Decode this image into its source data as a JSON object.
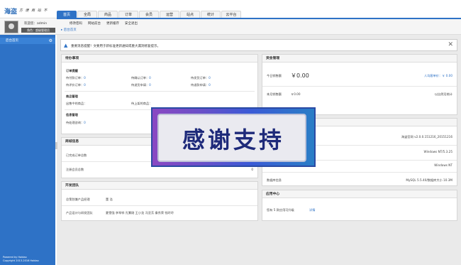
{
  "brand": {
    "logo": "海盗",
    "tagline": "方 便 商 站 不"
  },
  "nav": [
    "首页",
    "全局",
    "商品",
    "订单",
    "会员",
    "运营",
    "站点",
    "统计",
    "云平台"
  ],
  "user": {
    "welcome": "欢迎您：admin",
    "role": "角色：超级管理员",
    "links": [
      "修改密码",
      "网站前台",
      "更新缓存",
      "安全退出"
    ]
  },
  "sidebar": {
    "item": "后台首页",
    "footer": [
      "Powered by Haidao",
      "Copyright 2013-2016 Haidao"
    ]
  },
  "breadcrumb": "后台首页",
  "notice": "重要消息提醒！文要用于新标准更新通知或重大漏洞修复提示。",
  "todo": {
    "title": "待办事项",
    "order_title": "订单提醒",
    "order": [
      {
        "label": "待付款订单：",
        "value": "0"
      },
      {
        "label": "待确认订单：",
        "value": "0"
      },
      {
        "label": "待发货订单：",
        "value": "0"
      },
      {
        "label": "待评价订单：",
        "value": "0"
      },
      {
        "label": "待退货申请：",
        "value": "0"
      },
      {
        "label": "待退款申请：",
        "value": "0"
      }
    ],
    "goods_title": "商品管理",
    "goods": [
      {
        "label": "出售中的商品：",
        "value": ""
      },
      {
        "label": "待上架的商品：",
        "value": ""
      }
    ],
    "info_title": "信息管理",
    "info": [
      {
        "label": "待处理咨询：",
        "value": "0"
      }
    ]
  },
  "shop": {
    "title": "商城信息",
    "rows": [
      {
        "label": "已完成订单总数",
        "value": ""
      },
      {
        "label": "注册会员总数",
        "value": "0"
      }
    ]
  },
  "team": {
    "title": "开发团队",
    "rows": [
      {
        "label": "总策划兼产品经理",
        "value": "董 浩"
      },
      {
        "label": "产品设计与研发团队",
        "value": "夏雪强   李琴祥   孔繁刚   王小龙   冯亚芳   秦秀荣   钱玲玲"
      }
    ]
  },
  "funds": {
    "title": "资金管理",
    "today_label": "今日销售额",
    "today_value": "￥0.00",
    "avg_label": "人均客单价：",
    "avg_value": "￥ 0.00",
    "month_label": "本月销售额",
    "month_value": "￥0.00",
    "month_link": "以自然月统计"
  },
  "system": {
    "rows": [
      {
        "label": "",
        "value": "海盗官网 v2.0.0.151216_20151216"
      },
      {
        "label": "",
        "value": "Windows NT/5.3.25"
      },
      {
        "label": "服务器软件",
        "value": "Windows NT"
      },
      {
        "label": "数据库信息",
        "value": "MySQL 5.5.40/数据库大小 10.3M"
      }
    ]
  },
  "apps": {
    "title": "应用中心",
    "text": "您有 5 款应用可升级",
    "link": "详情"
  },
  "overlay": "感谢支持"
}
